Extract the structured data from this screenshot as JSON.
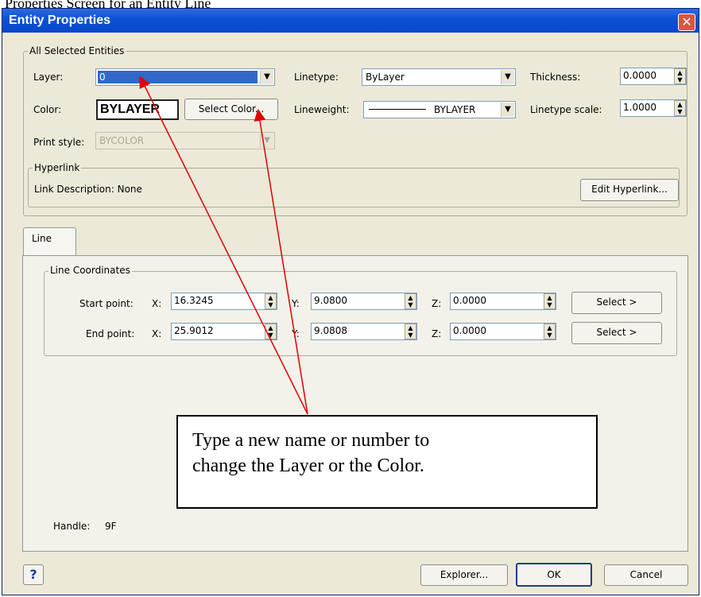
{
  "caption": "Properties Screen for an Entity Line",
  "window": {
    "title": "Entity Properties",
    "close_glyph": "✕"
  },
  "all_selected": {
    "group_label": "All Selected Entities",
    "layer_label": "Layer:",
    "layer_value": "0",
    "linetype_label": "Linetype:",
    "linetype_value": "ByLayer",
    "thickness_label": "Thickness:",
    "thickness_value": "0.0000",
    "color_label": "Color:",
    "color_value": "BYLAYER",
    "select_color_label": "Select Color...",
    "lineweight_label": "Lineweight:",
    "lineweight_value": "BYLAYER",
    "linetype_scale_label": "Linetype scale:",
    "linetype_scale_value": "1.0000",
    "print_style_label": "Print style:",
    "print_style_value": "BYCOLOR",
    "hyperlink_group_label": "Hyperlink",
    "link_description": "Link Description: None",
    "edit_hyperlink_label": "Edit Hyperlink..."
  },
  "tabs": [
    {
      "label": "Line"
    }
  ],
  "line_coords": {
    "group_label": "Line Coordinates",
    "start_label": "Start point:",
    "end_label": "End point:",
    "x_label": "X:",
    "y_label": "Y:",
    "z_label": "Z:",
    "start": {
      "x": "16.3245",
      "y": "9.0800",
      "z": "0.0000"
    },
    "end": {
      "x": "25.9012",
      "y": "9.0808",
      "z": "0.0000"
    },
    "select_label": "Select >"
  },
  "handle": {
    "label": "Handle:",
    "value": "9F"
  },
  "footer": {
    "help_glyph": "?",
    "explorer_label": "Explorer...",
    "ok_label": "OK",
    "cancel_label": "Cancel"
  },
  "annotation": {
    "line1": "Type a new name or number to",
    "line2": "change the Layer or the Color.",
    "arrow_color": "#e00000"
  },
  "colors": {
    "title_bar": "#0b53d6",
    "dialog_bg": "#ece9d8",
    "layer_highlight": "#3168c8"
  }
}
